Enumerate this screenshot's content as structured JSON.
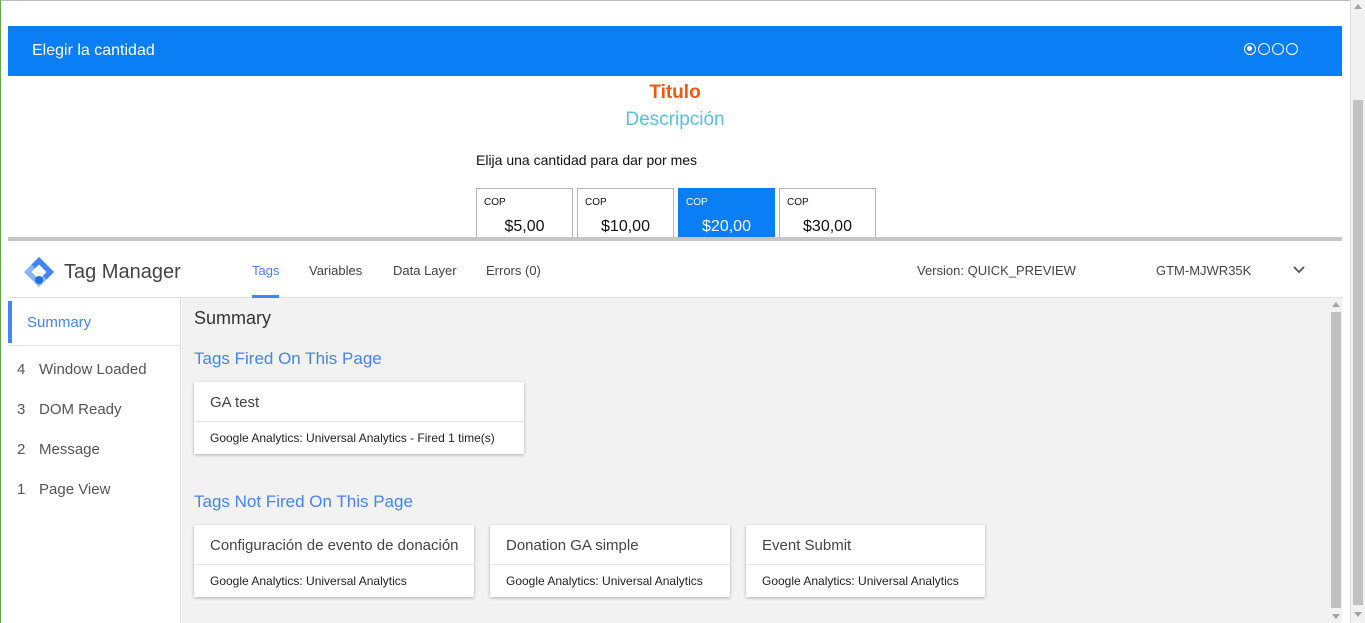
{
  "colors": {
    "widget_header_bg": "#0a7ff5",
    "title_color": "#ef5b0c",
    "description_color": "#5bc0de",
    "gtm_accent": "#4285f4"
  },
  "donation_widget": {
    "header_title": "Elegir la cantidad",
    "step_indicator": {
      "total": 4,
      "active_index": 0
    },
    "title": "Titulo",
    "description": "Descripción",
    "prompt": "Elija una cantidad para dar por mes",
    "amounts": [
      {
        "currency": "COP",
        "value": "$5,00",
        "selected": false
      },
      {
        "currency": "COP",
        "value": "$10,00",
        "selected": false
      },
      {
        "currency": "COP",
        "value": "$20,00",
        "selected": true
      },
      {
        "currency": "COP",
        "value": "$30,00",
        "selected": false
      }
    ]
  },
  "gtm": {
    "product_name": "Tag Manager",
    "logo_icon": "tag-manager-diamond-icon",
    "tabs": [
      {
        "label": "Tags",
        "active": true
      },
      {
        "label": "Variables",
        "active": false
      },
      {
        "label": "Data Layer",
        "active": false
      },
      {
        "label": "Errors (0)",
        "active": false
      }
    ],
    "version": "Version: QUICK_PREVIEW",
    "container_id": "GTM-MJWR35K",
    "sidebar": {
      "summary_label": "Summary",
      "events": [
        {
          "number": "4",
          "label": "Window Loaded"
        },
        {
          "number": "3",
          "label": "DOM Ready"
        },
        {
          "number": "2",
          "label": "Message"
        },
        {
          "number": "1",
          "label": "Page View"
        }
      ]
    },
    "main": {
      "heading": "Summary",
      "fired_title": "Tags Fired On This Page",
      "fired_tags": [
        {
          "name": "GA test",
          "type": "Google Analytics: Universal Analytics - Fired 1 time(s)"
        }
      ],
      "not_fired_title": "Tags Not Fired On This Page",
      "not_fired_tags": [
        {
          "name": "Configuración de evento de donación",
          "type": "Google Analytics: Universal Analytics"
        },
        {
          "name": "Donation GA simple",
          "type": "Google Analytics: Universal Analytics"
        },
        {
          "name": "Event Submit",
          "type": "Google Analytics: Universal Analytics"
        }
      ]
    }
  }
}
